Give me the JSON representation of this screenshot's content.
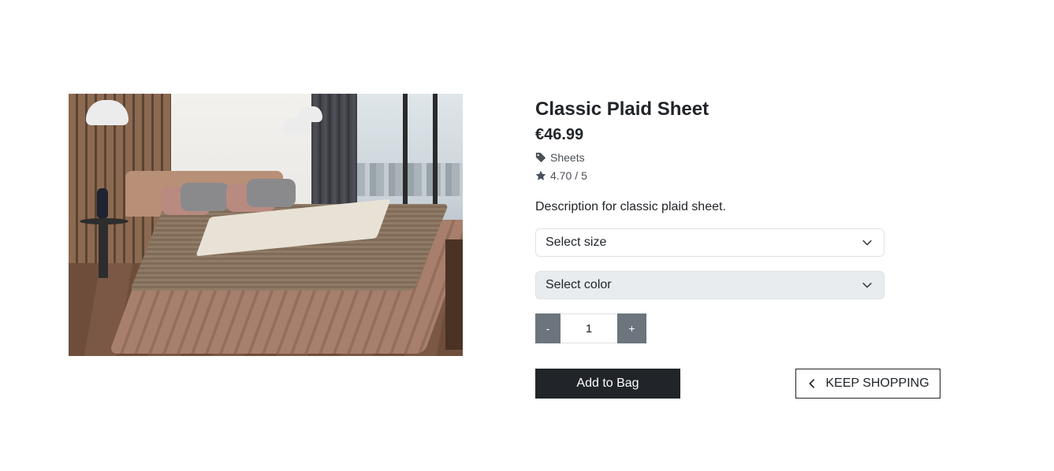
{
  "product": {
    "name": "Classic Plaid Sheet",
    "price": "€46.99",
    "category": "Sheets",
    "rating": "4.70",
    "rating_max": "5",
    "description": "Description for classic plaid sheet.",
    "image_icon": "bedroom-photo"
  },
  "options": {
    "size_placeholder": "Select size",
    "color_placeholder": "Select color"
  },
  "quantity": {
    "decrement_label": "-",
    "value": "1",
    "increment_label": "+"
  },
  "actions": {
    "add_to_bag_label": "Add to Bag",
    "keep_shopping_label": "KEEP SHOPPING"
  },
  "icons": {
    "category": "tag-icon",
    "rating": "star-icon",
    "select": "chevron-down-icon",
    "back": "chevron-left-icon"
  }
}
